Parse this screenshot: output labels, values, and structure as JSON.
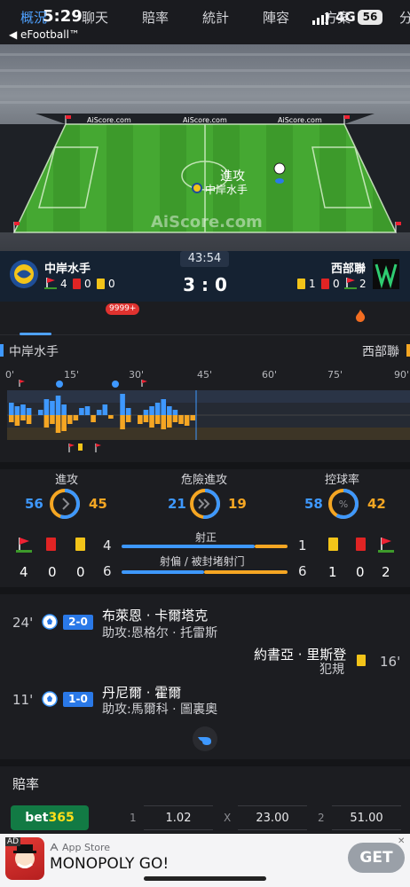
{
  "status_bar": {
    "time": "5:29",
    "back_app": "◀ eFootball™",
    "network": "4G",
    "battery": "56"
  },
  "pitch": {
    "sponsor": "AiScore.com",
    "watermark": "AiScore.com",
    "state_label": "進攻",
    "attacking_team": "中岸水手"
  },
  "match": {
    "home": {
      "name": "中岸水手",
      "corners": "4",
      "red": "0",
      "yellow": "0"
    },
    "away": {
      "name": "西部聯",
      "yellow": "1",
      "red": "0",
      "corners": "2"
    },
    "clock": "43:54",
    "score": "3 : 0"
  },
  "tabs": [
    {
      "label": "概況",
      "active": true
    },
    {
      "label": "聊天",
      "badge": "9999+"
    },
    {
      "label": "賠率"
    },
    {
      "label": "統計"
    },
    {
      "label": "陣容"
    },
    {
      "label": "方案"
    },
    {
      "label": "分"
    }
  ],
  "timeline": {
    "home": "中岸水手",
    "away": "西部聯",
    "ticks": [
      "0'",
      "15'",
      "30'",
      "45'",
      "60'",
      "75'",
      "90'"
    ],
    "colors": {
      "home": "#3e98ff",
      "away": "#f5a623"
    }
  },
  "stats": {
    "attack": {
      "label": "進攻",
      "home": "56",
      "away": "45"
    },
    "dangerous": {
      "label": "危險進攻",
      "home": "21",
      "away": "19"
    },
    "possession": {
      "label": "控球率",
      "home": "58",
      "away": "42"
    },
    "on_target": {
      "label": "射正",
      "home": "4",
      "away": "1"
    },
    "off_target": {
      "label": "射偏 / 被封堵射门",
      "home": "6",
      "away": "6"
    },
    "home_counts": {
      "corners": "4",
      "red": "0",
      "yellow": "0"
    },
    "away_counts": {
      "yellow": "1",
      "red": "0",
      "corners": "2"
    }
  },
  "events": [
    {
      "minute": "24'",
      "score": "2-0",
      "player": "布萊恩 · 卡爾塔克",
      "assist": "助攻:恩格尔 · 托雷斯"
    },
    {
      "minute": "16'",
      "player": "約書亞 · 里斯登",
      "note": "犯規"
    },
    {
      "minute": "11'",
      "score": "1-0",
      "player": "丹尼爾 · 霍爾",
      "assist": "助攻:馬爾科 · 圖裏奧"
    }
  ],
  "odds": {
    "title": "賠率",
    "bookmaker": {
      "a": "bet",
      "b": "365"
    },
    "k1": "1",
    "v1": "1.02",
    "kx": "X",
    "vx": "23.00",
    "k2": "2",
    "v2": "51.00"
  },
  "ad": {
    "tag": "AD",
    "store": "App Store",
    "title": "MONOPOLY GO!",
    "cta": "GET",
    "close": "✕"
  }
}
